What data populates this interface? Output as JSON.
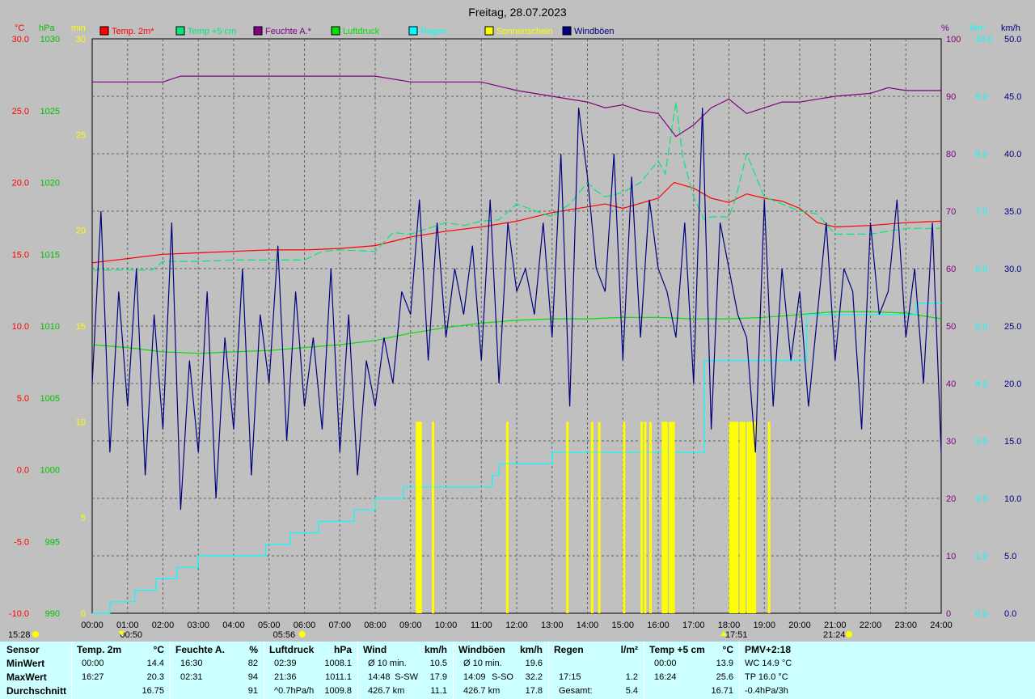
{
  "title": "Freitag, 28.07.2023",
  "axes": {
    "left_units": [
      "°C",
      "hPa",
      "min"
    ],
    "right_units": [
      "%",
      "l/m²",
      "km/h"
    ],
    "temp_ticks": [
      "30.0",
      "25.0",
      "20.0",
      "15.0",
      "10.0",
      "5.0",
      "0.0",
      "-5.0",
      "-10.0"
    ],
    "pressure_ticks": [
      "1030",
      "1025",
      "1020",
      "1015",
      "1010",
      "1005",
      "1000",
      "995",
      "990"
    ],
    "sun_ticks": [
      "30",
      "25",
      "20",
      "15",
      "10",
      "5",
      "0"
    ],
    "humidity_ticks": [
      "100",
      "90",
      "80",
      "70",
      "60",
      "50",
      "40",
      "30",
      "20",
      "10",
      "0"
    ],
    "rain_ticks": [
      "10.0",
      "9.0",
      "8.0",
      "7.0",
      "6.0",
      "5.0",
      "4.0",
      "3.0",
      "2.0",
      "1.0",
      "0.0"
    ],
    "wind_ticks": [
      "50.0",
      "45.0",
      "40.0",
      "35.0",
      "30.0",
      "25.0",
      "20.0",
      "15.0",
      "10.0",
      "5.0",
      "0.0"
    ],
    "x_ticks": [
      "00:00",
      "01:00",
      "02:00",
      "03:00",
      "04:00",
      "05:00",
      "06:00",
      "07:00",
      "08:00",
      "09:00",
      "10:00",
      "11:00",
      "12:00",
      "13:00",
      "14:00",
      "15:00",
      "16:00",
      "17:00",
      "18:00",
      "19:00",
      "20:00",
      "21:00",
      "22:00",
      "23:00",
      "24:00"
    ]
  },
  "sun_events": {
    "moonset": "00:50",
    "sunrise": "05:56",
    "sunset": "17:51",
    "moonrise_left": "15:28",
    "moonrise_right": "21:24"
  },
  "legend": [
    {
      "label": "Temp. 2m*",
      "color": "#ff0000"
    },
    {
      "label": "Temp +5 cm",
      "color": "#00e87a"
    },
    {
      "label": "Feuchte A.*",
      "color": "#800080"
    },
    {
      "label": "Luftdruck",
      "color": "#00e000"
    },
    {
      "label": "Regen",
      "color": "#00ffff"
    },
    {
      "label": "Sonnenschein",
      "color": "#ffff00"
    },
    {
      "label": "Windböen",
      "color": "#000080"
    }
  ],
  "stats": {
    "row_labels": [
      "Sensor",
      "MinWert",
      "MaxWert",
      "Durchschnitt"
    ],
    "blocks": [
      {
        "title": "Temp. 2m",
        "unit": "°C",
        "min_time": "00:00",
        "min_val": "14.4",
        "max_time": "16:27",
        "max_val": "20.3",
        "avg_time": "",
        "avg_val": "16.75"
      },
      {
        "title": "Feuchte A.",
        "unit": "%",
        "min_time": "16:30",
        "min_val": "82",
        "max_time": "02:31",
        "max_val": "94",
        "avg_time": "",
        "avg_val": "91"
      },
      {
        "title": "Luftdruck",
        "unit": "hPa",
        "min_time": "02:39",
        "min_val": "1008.1",
        "max_time": "21:36",
        "max_val": "1011.1",
        "avg_time": "^0.7hPa/h",
        "avg_val": "1009.8"
      },
      {
        "title": "Wind",
        "unit": "km/h",
        "min_time": "Ø 10 min.",
        "min_val": "10.5",
        "max_time": "14:48",
        "max_dir": "S-SW",
        "max_val": "17.9",
        "avg_time": "426.7 km",
        "avg_val": "11.1"
      },
      {
        "title": "Windböen",
        "unit": "km/h",
        "min_time": "Ø 10 min.",
        "min_val": "19.6",
        "max_time": "14:09",
        "max_dir": "S-SO",
        "max_val": "32.2",
        "avg_time": "426.7 km",
        "avg_val": "17.8"
      },
      {
        "title": "Regen",
        "unit": "l/m²",
        "min_time": "",
        "min_val": "",
        "max_time": "17:15",
        "max_val": "1.2",
        "avg_time": "Gesamt:",
        "avg_val": "5.4"
      },
      {
        "title": "Temp +5 cm",
        "unit": "°C",
        "min_time": "00:00",
        "min_val": "13.9",
        "max_time": "16:24",
        "max_val": "25.6",
        "avg_time": "",
        "avg_val": "16.71"
      }
    ],
    "pmv": {
      "title": "PMV+2:18",
      "line1": "WC 14.9 °C",
      "line2": "TP 16.0 °C",
      "line3": "-0.4hPa/3h"
    }
  },
  "chart_data": {
    "type": "line",
    "title": "Freitag, 28.07.2023",
    "x_unit": "hours",
    "xlim": [
      0,
      24
    ],
    "scales": {
      "temperature_C": [
        -10,
        30
      ],
      "pressure_hPa": [
        990,
        1030
      ],
      "sunshine_min": [
        0,
        30
      ],
      "humidity_pct": [
        0,
        100
      ],
      "rain_lm2": [
        0,
        10
      ],
      "wind_kmh": [
        0,
        50
      ]
    },
    "grid": true,
    "series": [
      {
        "name": "Temp. 2m*",
        "axis": "temperature_C",
        "color": "#ff0000",
        "x": [
          0,
          1,
          2,
          3,
          4,
          5,
          6,
          7,
          8,
          9,
          10,
          11,
          12,
          13,
          14,
          14.5,
          15,
          16,
          16.45,
          17,
          17.5,
          18,
          18.5,
          19,
          19.5,
          20,
          20.5,
          21,
          22,
          23,
          24
        ],
        "y": [
          14.4,
          14.7,
          15.0,
          15.1,
          15.2,
          15.3,
          15.3,
          15.4,
          15.6,
          16.2,
          16.6,
          16.9,
          17.3,
          17.9,
          18.3,
          18.5,
          18.2,
          18.9,
          20.0,
          19.6,
          18.9,
          18.6,
          19.2,
          18.9,
          18.7,
          18.2,
          17.2,
          16.9,
          17.0,
          17.2,
          17.3
        ]
      },
      {
        "name": "Temp +5 cm",
        "axis": "temperature_C",
        "color": "#00e87a",
        "x": [
          0,
          1,
          1.7,
          2,
          3,
          4,
          5,
          6,
          6.5,
          7,
          8,
          8.5,
          9,
          10,
          10.5,
          11,
          11.5,
          12,
          13,
          13.5,
          14,
          14.2,
          14.5,
          15,
          15.5,
          16,
          16.2,
          16.5,
          16.7,
          17,
          17.3,
          17.5,
          18,
          18.2,
          18.5,
          19,
          19.5,
          20,
          20.5,
          21,
          22,
          23,
          24
        ],
        "y": [
          13.9,
          13.9,
          13.9,
          14.5,
          14.5,
          14.6,
          14.6,
          14.6,
          15.2,
          15.3,
          15.2,
          16.5,
          16.4,
          17.2,
          17.0,
          17.3,
          17.4,
          18.5,
          17.6,
          18.5,
          20.0,
          19.5,
          19.0,
          19.3,
          20.0,
          21.5,
          20.6,
          25.6,
          21.7,
          19.0,
          17.4,
          17.6,
          17.6,
          19.0,
          22.0,
          19.0,
          18.5,
          18.0,
          17.8,
          16.4,
          16.4,
          16.8,
          16.8
        ]
      },
      {
        "name": "Feuchte A.*",
        "axis": "humidity_pct",
        "color": "#800080",
        "x": [
          0,
          2,
          2.5,
          3,
          4,
          5,
          6,
          7,
          8,
          9,
          10,
          11,
          12,
          13,
          14,
          14.5,
          15,
          15.5,
          16,
          16.5,
          17,
          17.5,
          18,
          18.5,
          19,
          19.5,
          20,
          21,
          22,
          22.5,
          23,
          24
        ],
        "y": [
          92.5,
          92.5,
          93.5,
          93.5,
          93.5,
          93.5,
          93.5,
          93.5,
          93.5,
          92.5,
          92.5,
          92.5,
          91.0,
          90.0,
          89.0,
          88.0,
          88.5,
          87.5,
          87.0,
          83.0,
          85.0,
          88.0,
          89.5,
          87.0,
          88.0,
          89.0,
          89.0,
          90.0,
          90.5,
          91.5,
          91.0,
          91.0
        ]
      },
      {
        "name": "Luftdruck",
        "axis": "pressure_hPa",
        "color": "#00e000",
        "x": [
          0,
          1,
          2,
          3,
          4,
          5,
          6,
          7,
          8,
          9,
          10,
          11,
          12,
          13,
          14,
          15,
          16,
          17,
          18,
          19,
          20,
          21,
          22,
          23,
          24
        ],
        "y": [
          1008.7,
          1008.5,
          1008.2,
          1008.1,
          1008.2,
          1008.3,
          1008.5,
          1008.7,
          1009.0,
          1009.5,
          1009.9,
          1010.2,
          1010.4,
          1010.5,
          1010.5,
          1010.6,
          1010.6,
          1010.5,
          1010.5,
          1010.6,
          1010.8,
          1011.0,
          1011.0,
          1010.9,
          1010.5
        ]
      },
      {
        "name": "Regen",
        "axis": "rain_lm2",
        "type": "step",
        "color": "#00ffff",
        "x": [
          0,
          0.5,
          1.2,
          1.8,
          2.4,
          3.0,
          4.0,
          4.9,
          5.6,
          6.4,
          7.4,
          8.0,
          8.8,
          9.3,
          9.8,
          10.0,
          10.9,
          11.3,
          11.5,
          12.0,
          13.0,
          17.0,
          17.3,
          18.0,
          19.0,
          20.0,
          20.2,
          21.0,
          22.0,
          23.0,
          23.3,
          24.0
        ],
        "y": [
          0,
          0.2,
          0.4,
          0.6,
          0.8,
          1.0,
          1.0,
          1.2,
          1.4,
          1.6,
          1.8,
          2.0,
          2.2,
          2.2,
          2.2,
          2.2,
          2.2,
          2.4,
          2.6,
          2.6,
          2.8,
          2.8,
          4.4,
          4.4,
          4.4,
          4.4,
          5.2,
          5.2,
          5.2,
          5.2,
          5.4,
          5.4
        ]
      },
      {
        "name": "Sonnenschein",
        "axis": "sunshine_min",
        "type": "bars",
        "color": "#ffff00",
        "x": [
          9.15,
          9.2,
          9.25,
          9.6,
          11.7,
          13.4,
          14.1,
          14.3,
          15.0,
          15.5,
          15.6,
          15.75,
          16.1,
          16.15,
          16.2,
          16.3,
          16.35,
          16.4,
          18.0,
          18.05,
          18.1,
          18.15,
          18.2,
          18.3,
          18.35,
          18.4,
          18.5,
          18.55,
          18.6,
          18.65,
          18.7,
          19.1
        ],
        "y": [
          10,
          10,
          10,
          10,
          10,
          10,
          10,
          10,
          10,
          10,
          10,
          10,
          10,
          10,
          10,
          10,
          10,
          10,
          10,
          10,
          10,
          10,
          10,
          10,
          10,
          10,
          10,
          10,
          10,
          10,
          10,
          10
        ]
      },
      {
        "name": "Windböen",
        "axis": "wind_kmh",
        "color": "#000080",
        "x": [
          0,
          0.25,
          0.5,
          0.75,
          1,
          1.25,
          1.5,
          1.75,
          2,
          2.25,
          2.5,
          2.75,
          3,
          3.25,
          3.5,
          3.75,
          4,
          4.25,
          4.5,
          4.75,
          5,
          5.25,
          5.5,
          5.75,
          6,
          6.25,
          6.5,
          6.75,
          7,
          7.25,
          7.5,
          7.75,
          8,
          8.25,
          8.5,
          8.75,
          9,
          9.25,
          9.5,
          9.75,
          10,
          10.25,
          10.5,
          10.75,
          11,
          11.25,
          11.5,
          11.75,
          12,
          12.25,
          12.5,
          12.75,
          13,
          13.25,
          13.5,
          13.75,
          14,
          14.25,
          14.5,
          14.75,
          15,
          15.25,
          15.5,
          15.75,
          16,
          16.25,
          16.5,
          16.75,
          17,
          17.25,
          17.5,
          17.75,
          18,
          18.25,
          18.5,
          18.75,
          19,
          19.25,
          19.5,
          19.75,
          20,
          20.25,
          20.5,
          20.75,
          21,
          21.25,
          21.5,
          21.75,
          22,
          22.25,
          22.5,
          22.75,
          23,
          23.25,
          23.5,
          23.75,
          24
        ],
        "y": [
          20,
          35,
          14,
          28,
          18,
          30,
          12,
          26,
          16,
          34,
          9,
          22,
          14,
          28,
          10,
          24,
          16,
          30,
          12,
          26,
          20,
          32,
          15,
          28,
          18,
          24,
          16,
          30,
          14,
          26,
          12,
          22,
          18,
          24,
          20,
          28,
          26,
          36,
          22,
          34,
          24,
          30,
          26,
          32,
          22,
          36,
          20,
          34,
          28,
          30,
          26,
          34,
          24,
          40,
          18,
          44,
          38,
          30,
          28,
          40,
          22,
          38,
          24,
          36,
          30,
          28,
          24,
          34,
          20,
          44,
          16,
          34,
          30,
          26,
          24,
          14,
          36,
          18,
          30,
          22,
          28,
          18,
          26,
          34,
          22,
          30,
          28,
          16,
          34,
          26,
          28,
          36,
          24,
          30,
          20,
          34,
          14
        ]
      }
    ]
  }
}
